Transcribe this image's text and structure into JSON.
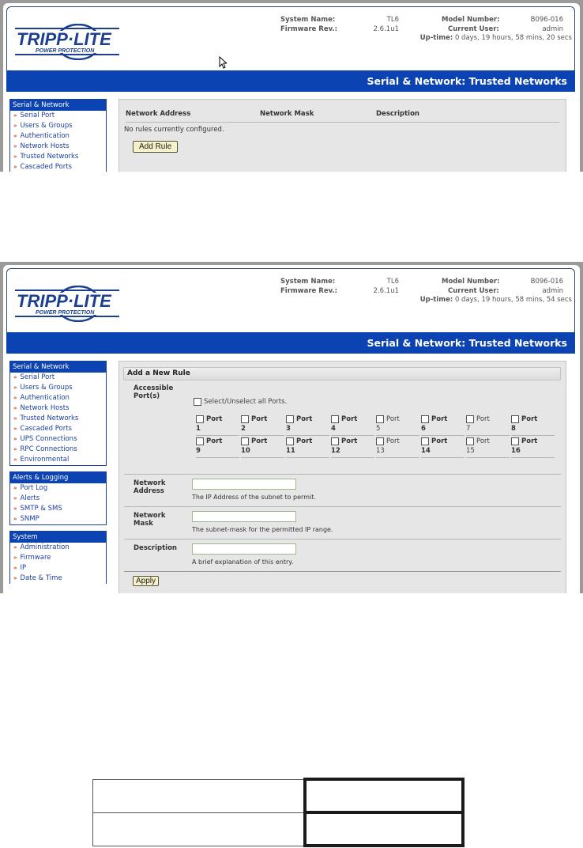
{
  "screens": [
    {
      "system_info": {
        "system_name_label": "System Name:",
        "system_name": "TL6",
        "firmware_label": "Firmware Rev.:",
        "firmware": "2.6.1u1",
        "model_label": "Model Number:",
        "model": "B096-016",
        "user_label": "Current User:",
        "user": "admin",
        "uptime_label": "Up-time:",
        "uptime": "0 days, 19 hours, 58 mins, 20 secs"
      },
      "logo": {
        "brand": "TRIPP·LITE",
        "tagline": "POWER PROTECTION"
      },
      "page_title": "Serial & Network: Trusted Networks",
      "sidebar": {
        "groups": [
          {
            "title": "Serial & Network",
            "items": [
              "Serial Port",
              "Users & Groups",
              "Authentication",
              "Network Hosts",
              "Trusted Networks",
              "Cascaded Ports"
            ]
          }
        ]
      },
      "table": {
        "columns": [
          "Network Address",
          "Network Mask",
          "Description"
        ],
        "empty_message": "No rules currently configured.",
        "add_button": "Add Rule"
      }
    },
    {
      "system_info": {
        "system_name_label": "System Name:",
        "system_name": "TL6",
        "firmware_label": "Firmware Rev.:",
        "firmware": "2.6.1u1",
        "model_label": "Model Number:",
        "model": "B096-016",
        "user_label": "Current User:",
        "user": "admin",
        "uptime_label": "Up-time:",
        "uptime": "0 days, 19 hours, 58 mins, 54 secs"
      },
      "logo": {
        "brand": "TRIPP·LITE",
        "tagline": "POWER PROTECTION"
      },
      "page_title": "Serial & Network: Trusted Networks",
      "sidebar": {
        "groups": [
          {
            "title": "Serial & Network",
            "items": [
              "Serial Port",
              "Users & Groups",
              "Authentication",
              "Network Hosts",
              "Trusted Networks",
              "Cascaded Ports",
              "UPS Connections",
              "RPC Connections",
              "Environmental"
            ]
          },
          {
            "title": "Alerts & Logging",
            "items": [
              "Port Log",
              "Alerts",
              "SMTP & SMS",
              "SNMP"
            ]
          },
          {
            "title": "System",
            "items": [
              "Administration",
              "Firmware",
              "IP",
              "Date & Time"
            ]
          }
        ]
      },
      "form": {
        "title": "Add a New Rule",
        "ports_label": "Accessible Port(s)",
        "select_all_label": "Select/Unselect all Ports.",
        "port_word": "Port",
        "ports": [
          "1",
          "2",
          "3",
          "4",
          "5",
          "6",
          "7",
          "8",
          "9",
          "10",
          "11",
          "12",
          "13",
          "14",
          "15",
          "16"
        ],
        "fields": [
          {
            "label": "Network Address",
            "value": "",
            "hint": "The IP Address of the subnet to permit."
          },
          {
            "label": "Network Mask",
            "value": "",
            "hint": "The subnet-mask for the permitted IP range."
          },
          {
            "label": "Description",
            "value": "",
            "hint": "A brief explanation of this entry."
          }
        ],
        "apply_button": "Apply"
      }
    }
  ]
}
